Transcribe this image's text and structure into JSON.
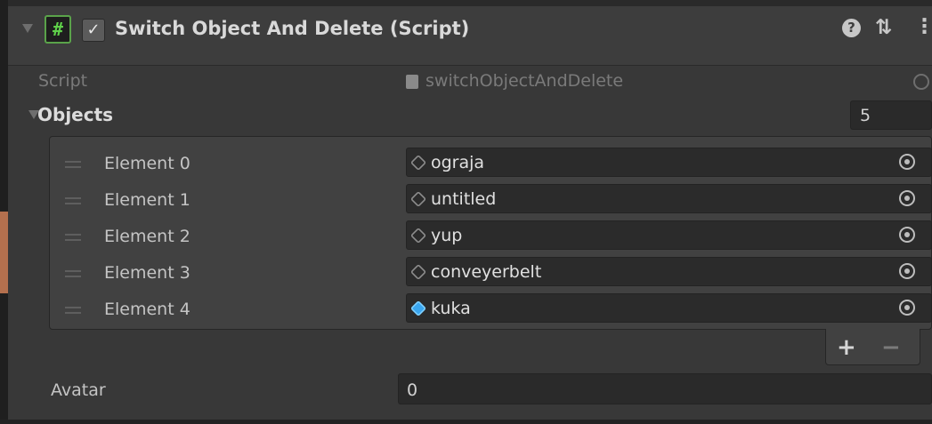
{
  "component": {
    "title": "Switch Object And Delete (Script)",
    "enabled_checkbox": "✓",
    "script_icon": "#",
    "icons": [
      "foldout-arrow-icon",
      "script-icon",
      "help-icon",
      "presets-icon",
      "menu-icon"
    ]
  },
  "script_field": {
    "label": "Script",
    "value": "switchObjectAndDelete"
  },
  "objects": {
    "label": "Objects",
    "size": "5",
    "elements": [
      {
        "label": "Element 0",
        "value": "ograja",
        "icon": "gameobject-icon"
      },
      {
        "label": "Element 1",
        "value": "untitled",
        "icon": "gameobject-icon"
      },
      {
        "label": "Element 2",
        "value": "yup",
        "icon": "gameobject-icon"
      },
      {
        "label": "Element 3",
        "value": "conveyerbelt",
        "icon": "gameobject-icon"
      },
      {
        "label": "Element 4",
        "value": "kuka",
        "icon": "prefab-icon"
      }
    ],
    "add_label": "+",
    "remove_label": "−"
  },
  "avatar": {
    "label": "Avatar",
    "value": "0"
  },
  "colors": {
    "background": "#383838",
    "field": "#2b2b2b",
    "script_icon_green": "#5fd04a",
    "prefab_blue": "#3aa6ef"
  }
}
